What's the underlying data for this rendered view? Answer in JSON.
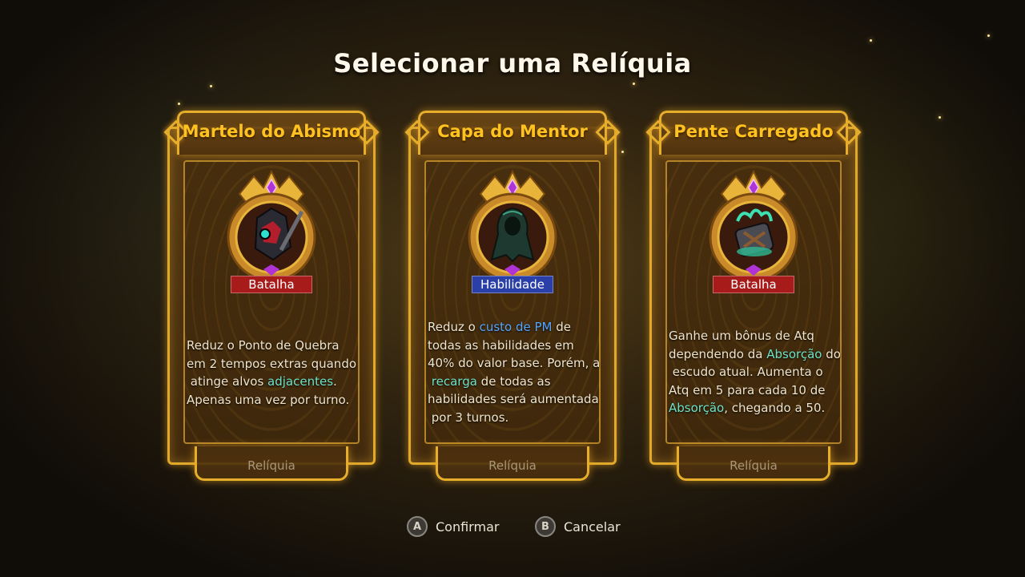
{
  "title": "Selecionar uma Relíquia",
  "cards": [
    {
      "name": "Martelo do Abismo",
      "tag": "Batalha",
      "tag_color": "#a71b1b",
      "icon": "abyss-hammer-icon",
      "desc_lines": [
        [
          {
            "t": "Reduz o Ponto de Quebra"
          }
        ],
        [
          {
            "t": "em 2 tempos extras quando"
          }
        ],
        [
          {
            "t": " atinge alvos "
          },
          {
            "t": "adjacentes",
            "hl": true
          },
          {
            "t": "."
          }
        ],
        [
          {
            "t": "Apenas uma vez por turno."
          }
        ]
      ],
      "footer": "Relíquia"
    },
    {
      "name": "Capa do Mentor",
      "tag": "Habilidade",
      "tag_color": "#2b3fa8",
      "icon": "mentor-cloak-icon",
      "desc_lines": [
        [
          {
            "t": "Reduz o "
          },
          {
            "t": "custo de PM",
            "hlb": true
          },
          {
            "t": " de"
          }
        ],
        [
          {
            "t": "todas as habilidades em"
          }
        ],
        [
          {
            "t": "40% do valor base. Porém, a"
          }
        ],
        [
          {
            "t": " "
          },
          {
            "t": "recarga",
            "hl": true
          },
          {
            "t": " de todas as"
          }
        ],
        [
          {
            "t": "habilidades será aumentada"
          }
        ],
        [
          {
            "t": " por 3 turnos."
          }
        ]
      ],
      "footer": "Relíquia"
    },
    {
      "name": "Pente Carregado",
      "tag": "Batalha",
      "tag_color": "#a71b1b",
      "icon": "charged-comb-icon",
      "desc_lines": [
        [
          {
            "t": "Ganhe um bônus de Atq"
          }
        ],
        [
          {
            "t": "dependendo da "
          },
          {
            "t": "Absorção",
            "hl": true
          },
          {
            "t": " do"
          }
        ],
        [
          {
            "t": " escudo atual. Aumenta o"
          }
        ],
        [
          {
            "t": "Atq em 5 para cada 10 de"
          }
        ],
        [
          {
            "t": "Absorção",
            "hl": true
          },
          {
            "t": ", chegando a 50."
          }
        ]
      ],
      "footer": "Relíquia"
    }
  ],
  "buttons": {
    "confirm": {
      "glyph": "A",
      "label": "Confirmar"
    },
    "cancel": {
      "glyph": "B",
      "label": "Cancelar"
    }
  },
  "colors": {
    "gold": "#e7ae2c",
    "title_gold": "#ffc21f",
    "highlight_teal": "#6ee2c8",
    "highlight_blue": "#55a6ff"
  }
}
